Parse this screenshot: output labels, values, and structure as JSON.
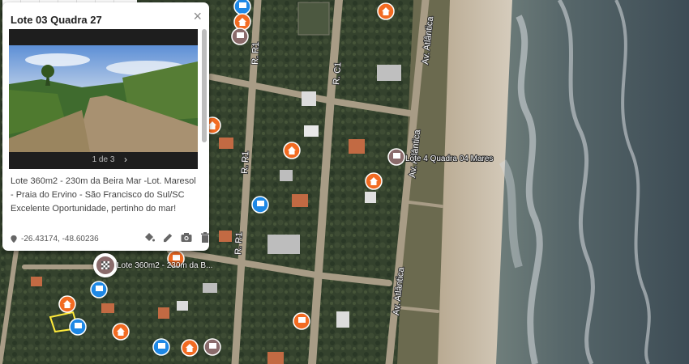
{
  "map": {
    "streets": [
      "R. R1",
      "R. R1",
      "R. R1",
      "R. C1",
      "Av. Atlântica",
      "Av. Atlântica",
      "Av. Atlântica"
    ],
    "labels": {
      "lote4": "Lote 4 Quadra 04 Mares",
      "selected": "Lote 360m2 - 230m da B..."
    },
    "colors": {
      "orange": "#f26b22",
      "blue": "#1e88e5",
      "grey": "#8a6b6b",
      "highlight": "#ffeb3b"
    }
  },
  "toolbar": {
    "tools": [
      {
        "name": "undo-button",
        "icon": "undo-icon"
      },
      {
        "name": "redo-button",
        "icon": "redo-icon"
      },
      {
        "name": "pan-button",
        "icon": "hand-icon"
      },
      {
        "name": "add-marker-button",
        "icon": "pin-icon"
      },
      {
        "name": "draw-line-button",
        "icon": "line-icon"
      },
      {
        "name": "route-button",
        "icon": "route-icon"
      },
      {
        "name": "measure-button",
        "icon": "ruler-icon"
      }
    ]
  },
  "infowindow": {
    "title": "Lote 03 Quadra 27",
    "gallery_counter": "1 de 3",
    "description": "Lote 360m2 - 230m da Beira Mar -Lot. Maresol - Praia do Ervino - São Francisco do Sul/SC Excelente Oportunidade, pertinho do mar!",
    "coords": "-26.43174, -48.60236"
  }
}
